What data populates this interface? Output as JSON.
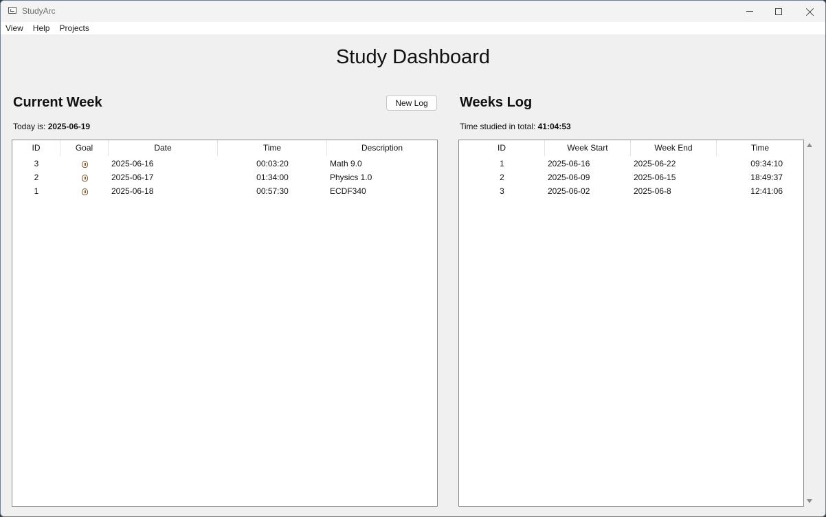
{
  "window": {
    "title": "StudyArc"
  },
  "menu": [
    "View",
    "Help",
    "Projects"
  ],
  "page_title": "Study Dashboard",
  "current_week": {
    "title": "Current Week",
    "new_log_label": "New Log",
    "today_label": "Today is:",
    "today_value": "2025-06-19",
    "columns": [
      "ID",
      "Goal",
      "Date",
      "Time",
      "Description"
    ],
    "rows": [
      {
        "id": "3",
        "goal_icon": "goal-icon",
        "date": "2025-06-16",
        "time": "00:03:20",
        "description": "Math 9.0"
      },
      {
        "id": "2",
        "goal_icon": "goal-icon",
        "date": "2025-06-17",
        "time": "01:34:00",
        "description": "Physics 1.0"
      },
      {
        "id": "1",
        "goal_icon": "goal-icon",
        "date": "2025-06-18",
        "time": "00:57:30",
        "description": "ECDF340"
      }
    ]
  },
  "weeks_log": {
    "title": "Weeks Log",
    "total_label": "Time studied in total:",
    "total_value": "41:04:53",
    "columns": [
      "ID",
      "Week Start",
      "Week End",
      "Time"
    ],
    "rows": [
      {
        "id": "1",
        "week_start": "2025-06-16",
        "week_end": "2025-06-22",
        "time": "09:34:10"
      },
      {
        "id": "2",
        "week_start": "2025-06-09",
        "week_end": "2025-06-15",
        "time": "18:49:37"
      },
      {
        "id": "3",
        "week_start": "2025-06-02",
        "week_end": "2025-06-8",
        "time": "12:41:06"
      }
    ]
  }
}
